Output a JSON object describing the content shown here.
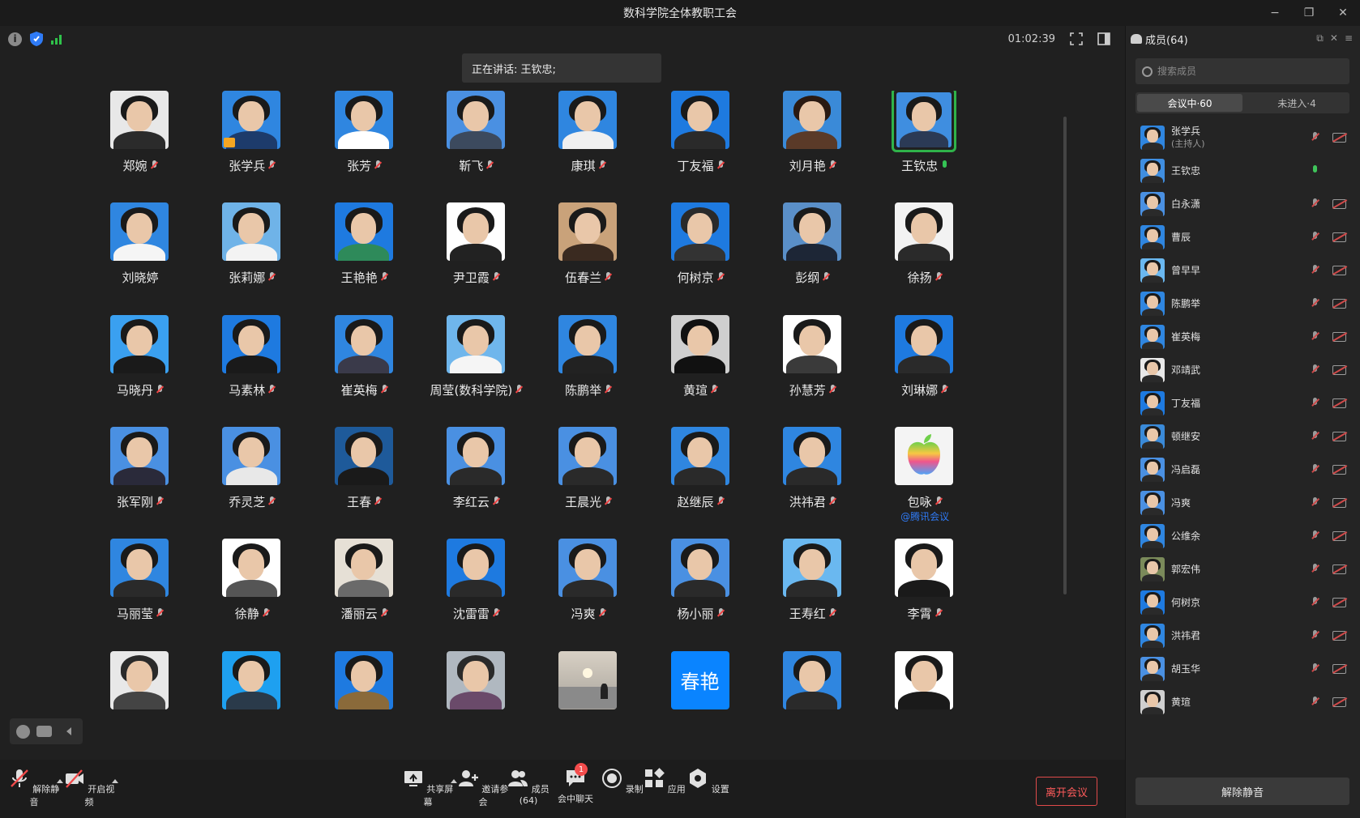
{
  "window": {
    "title": "数科学院全体教职工会",
    "minimize": "−",
    "restore": "❐",
    "close": "✕"
  },
  "topbar": {
    "timer": "01:02:39",
    "speaking": "正在讲话: 王钦忠;"
  },
  "colors": {
    "bg": "#202020",
    "accent_green": "#2fb34a",
    "leave_red": "#e04a4a",
    "link_blue": "#2f7bf6"
  },
  "participants": [
    {
      "name": "郑婉",
      "bg": "#e8e8e8",
      "shirt": "#2b2b2b",
      "hair": "#1a1a1a",
      "mic": "muted"
    },
    {
      "name": "张学兵",
      "bg": "#2f86e0",
      "shirt": "#1d3b6b",
      "hair": "#1a1a1a",
      "mic": "muted",
      "host": true
    },
    {
      "name": "张芳",
      "bg": "#2f86e0",
      "shirt": "#ffffff",
      "hair": "#1a1a1a",
      "mic": "muted"
    },
    {
      "name": "靳飞",
      "bg": "#4a90e2",
      "shirt": "#3c4a5e",
      "hair": "#1a1a1a",
      "mic": "muted"
    },
    {
      "name": "康琪",
      "bg": "#2f86e0",
      "shirt": "#f0f0f0",
      "hair": "#1a1a1a",
      "mic": "muted"
    },
    {
      "name": "丁友福",
      "bg": "#1e7ae0",
      "shirt": "#2a2a2a",
      "hair": "#1a1a1a",
      "mic": "muted"
    },
    {
      "name": "刘月艳",
      "bg": "#3a8ad8",
      "shirt": "#5a3a28",
      "hair": "#2a1a12",
      "mic": "muted"
    },
    {
      "name": "王钦忠",
      "bg": "#3f8ee0",
      "shirt": "#2b3a55",
      "hair": "#1a1a1a",
      "mic": "speaking",
      "active": true
    },
    {
      "name": "刘晓婷",
      "bg": "#2f86e0",
      "shirt": "#f5f5f5",
      "hair": "#1a1a1a",
      "mic": "none"
    },
    {
      "name": "张莉娜",
      "bg": "#6fb3e8",
      "shirt": "#f3f3f3",
      "hair": "#1a1a1a",
      "mic": "muted"
    },
    {
      "name": "王艳艳",
      "bg": "#1e7ae0",
      "shirt": "#2e8a5a",
      "hair": "#1a1a1a",
      "mic": "muted"
    },
    {
      "name": "尹卫霞",
      "bg": "#ffffff",
      "shirt": "#222222",
      "hair": "#1a1a1a",
      "mic": "muted"
    },
    {
      "name": "伍春兰",
      "bg": "#c9a27a",
      "shirt": "#3a2a20",
      "hair": "#1a1a1a",
      "mic": "muted"
    },
    {
      "name": "何树京",
      "bg": "#1e7ae0",
      "shirt": "#333333",
      "hair": "#2a2a2a",
      "mic": "muted"
    },
    {
      "name": "彭纲",
      "bg": "#5a8fc8",
      "shirt": "#1d2636",
      "hair": "#1a1a1a",
      "mic": "muted"
    },
    {
      "name": "徐扬",
      "bg": "#f2f2f2",
      "shirt": "#2a2a2a",
      "hair": "#1a1a1a",
      "mic": "muted"
    },
    {
      "name": "马晓丹",
      "bg": "#3aa0f0",
      "shirt": "#1a1a1a",
      "hair": "#1a1a1a",
      "mic": "muted"
    },
    {
      "name": "马素林",
      "bg": "#1e7ae0",
      "shirt": "#1a1a1a",
      "hair": "#1a1a1a",
      "mic": "muted"
    },
    {
      "name": "崔英梅",
      "bg": "#2f86e0",
      "shirt": "#3a3a4a",
      "hair": "#1a1a1a",
      "mic": "muted"
    },
    {
      "name": "周莹(数科学院)",
      "bg": "#6fb6ec",
      "shirt": "#f5f5f5",
      "hair": "#1a1a1a",
      "mic": "muted"
    },
    {
      "name": "陈鹏举",
      "bg": "#2f86e0",
      "shirt": "#222222",
      "hair": "#1a1a1a",
      "mic": "muted"
    },
    {
      "name": "黄瑄",
      "bg": "#cfcfcf",
      "shirt": "#111111",
      "hair": "#111111",
      "mic": "muted"
    },
    {
      "name": "孙慧芳",
      "bg": "#ffffff",
      "shirt": "#3a3a3a",
      "hair": "#1a1a1a",
      "mic": "muted"
    },
    {
      "name": "刘琳娜",
      "bg": "#1e7ae0",
      "shirt": "#2a2a2a",
      "hair": "#1a1a1a",
      "mic": "muted"
    },
    {
      "name": "张军刚",
      "bg": "#4a90e2",
      "shirt": "#2a2a3a",
      "hair": "#1a1a1a",
      "mic": "muted"
    },
    {
      "name": "乔灵芝",
      "bg": "#4a90e2",
      "shirt": "#e8e8e8",
      "hair": "#1a1a1a",
      "mic": "muted"
    },
    {
      "name": "王春",
      "bg": "#1e5a9a",
      "shirt": "#1a1a1a",
      "hair": "#1a1a1a",
      "mic": "muted"
    },
    {
      "name": "李红云",
      "bg": "#4a90e2",
      "shirt": "#2a2a2a",
      "hair": "#1a1a1a",
      "mic": "muted"
    },
    {
      "name": "王晨光",
      "bg": "#4a90e2",
      "shirt": "#2a2a2a",
      "hair": "#1a1a1a",
      "mic": "muted"
    },
    {
      "name": "赵继辰",
      "bg": "#2f86e0",
      "shirt": "#2a2a2a",
      "hair": "#1a1a1a",
      "mic": "muted"
    },
    {
      "name": "洪祎君",
      "bg": "#2f86e0",
      "shirt": "#2a2a2a",
      "hair": "#1a1a1a",
      "mic": "muted"
    },
    {
      "name": "包咏",
      "bg": "#f4f4f4",
      "shirt": "#f4f4f4",
      "hair": "#f4f4f4",
      "mic": "muted",
      "apple": true,
      "sub": "@腾讯会议"
    },
    {
      "name": "马丽莹",
      "bg": "#2f86e0",
      "shirt": "#2a2a2a",
      "hair": "#1a1a1a",
      "mic": "muted"
    },
    {
      "name": "徐静",
      "bg": "#ffffff",
      "shirt": "#555555",
      "hair": "#1a1a1a",
      "mic": "muted"
    },
    {
      "name": "潘丽云",
      "bg": "#e6e0d6",
      "shirt": "#6a6a6a",
      "hair": "#1a1a1a",
      "mic": "muted"
    },
    {
      "name": "沈雷雷",
      "bg": "#1e7ae0",
      "shirt": "#2a2a2a",
      "hair": "#1a1a1a",
      "mic": "muted"
    },
    {
      "name": "冯爽",
      "bg": "#4a90e2",
      "shirt": "#2a2a2a",
      "hair": "#1a1a1a",
      "mic": "muted"
    },
    {
      "name": "杨小丽",
      "bg": "#4a90e2",
      "shirt": "#2a2a2a",
      "hair": "#1a1a1a",
      "mic": "muted"
    },
    {
      "name": "王寿红",
      "bg": "#6ab8f0",
      "shirt": "#2a2a2a",
      "hair": "#1a1a1a",
      "mic": "muted"
    },
    {
      "name": "李霄",
      "bg": "#ffffff",
      "shirt": "#1a1a1a",
      "hair": "#1a1a1a",
      "mic": "muted"
    },
    {
      "name": "",
      "bg": "#e8e8e8",
      "shirt": "#444444",
      "hair": "#2a2a2a",
      "mic": "none"
    },
    {
      "name": "",
      "bg": "#1ea0f0",
      "shirt": "#2a3a4a",
      "hair": "#1a1a1a",
      "mic": "none"
    },
    {
      "name": "",
      "bg": "#1e7ae0",
      "shirt": "#8a6a3a",
      "hair": "#1a1a1a",
      "mic": "none"
    },
    {
      "name": "",
      "bg": "#b0b8c0",
      "shirt": "#6a4a6a",
      "hair": "#2a2a2a",
      "mic": "none"
    },
    {
      "name": "",
      "bg": "#c8c0b0",
      "shirt": "#6a6a6a",
      "hair": "#c8c0b0",
      "mic": "none",
      "landscape": true
    },
    {
      "name": "",
      "bg": "#0a84ff",
      "mic": "none",
      "text_avatar": "春艳"
    },
    {
      "name": "",
      "bg": "#2f86e0",
      "shirt": "#2a2a2a",
      "hair": "#1a1a1a",
      "mic": "none"
    },
    {
      "name": "",
      "bg": "#ffffff",
      "shirt": "#1a1a1a",
      "hair": "#1a1a1a",
      "mic": "none"
    }
  ],
  "toolbar": {
    "unmute": "解除静音",
    "video": "开启视频",
    "share": "共享屏幕",
    "invite": "邀请参会",
    "members": "成员(64)",
    "chat": "会中聊天",
    "chat_badge": "1",
    "record": "录制",
    "apps": "应用",
    "settings": "设置",
    "leave": "离开会议"
  },
  "sidebar": {
    "header": "成员(64)",
    "search_placeholder": "搜索成员",
    "tab_in": "会议中·60",
    "tab_not": "未进入·4",
    "unmute_all": "解除静音",
    "members": [
      {
        "name": "张学兵",
        "role": "(主持人)",
        "bg": "#2f86e0",
        "mic": "muted"
      },
      {
        "name": "王钦忠",
        "bg": "#3f8ee0",
        "mic": "on"
      },
      {
        "name": "白永潇",
        "bg": "#4a90e2",
        "mic": "muted"
      },
      {
        "name": "曹辰",
        "bg": "#2f86e0",
        "mic": "muted"
      },
      {
        "name": "曾早早",
        "bg": "#6ab8f0",
        "mic": "muted"
      },
      {
        "name": "陈鹏举",
        "bg": "#2f86e0",
        "mic": "muted"
      },
      {
        "name": "崔英梅",
        "bg": "#2f86e0",
        "mic": "muted"
      },
      {
        "name": "邓靖武",
        "bg": "#e8e8e8",
        "mic": "muted"
      },
      {
        "name": "丁友福",
        "bg": "#1e7ae0",
        "mic": "muted"
      },
      {
        "name": "顿继安",
        "bg": "#3a8ad8",
        "mic": "muted"
      },
      {
        "name": "冯启磊",
        "bg": "#4a90e2",
        "mic": "muted"
      },
      {
        "name": "冯爽",
        "bg": "#4a90e2",
        "mic": "muted"
      },
      {
        "name": "公维余",
        "bg": "#2f86e0",
        "mic": "muted"
      },
      {
        "name": "郭宏伟",
        "bg": "#7a8a5a",
        "mic": "muted"
      },
      {
        "name": "何树京",
        "bg": "#1e7ae0",
        "mic": "muted"
      },
      {
        "name": "洪祎君",
        "bg": "#2f86e0",
        "mic": "muted"
      },
      {
        "name": "胡玉华",
        "bg": "#4a90e2",
        "mic": "muted"
      },
      {
        "name": "黄瑄",
        "bg": "#cfcfcf",
        "mic": "muted"
      }
    ]
  }
}
